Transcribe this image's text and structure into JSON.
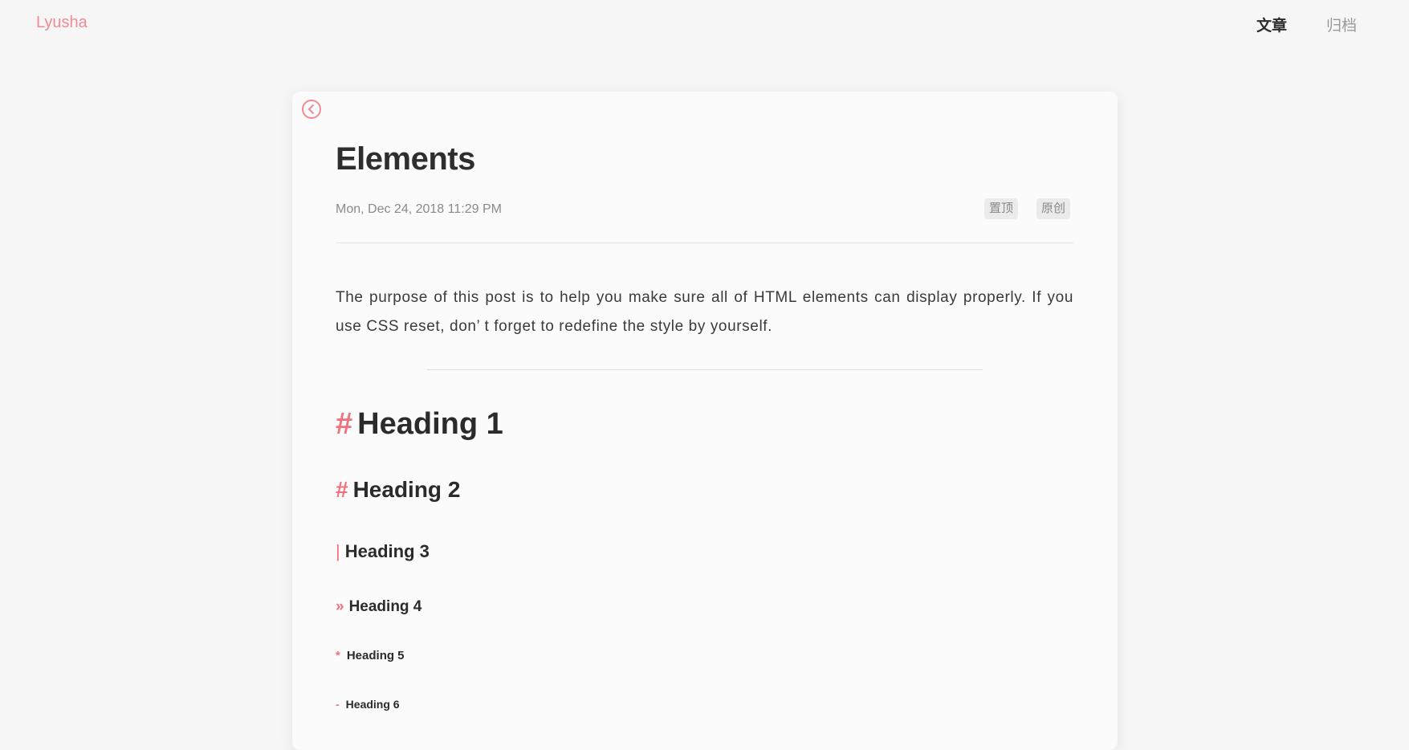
{
  "header": {
    "brand": "Lyusha",
    "nav": [
      {
        "label": "文章"
      },
      {
        "label": "归档"
      }
    ]
  },
  "post": {
    "title": "Elements",
    "date": "Mon, Dec 24, 2018 11:29 PM",
    "tags": [
      "置顶",
      "原创"
    ],
    "intro": "The purpose of this post is to help you make sure all of HTML elements can display properly. If you use CSS reset, don’ t forget to redefine the style by yourself.",
    "headings": [
      {
        "marker": "#",
        "text": "Heading 1"
      },
      {
        "marker": "#",
        "text": "Heading 2"
      },
      {
        "marker": "|",
        "text": "Heading 3"
      },
      {
        "marker": "»",
        "text": "Heading 4"
      },
      {
        "marker": "*",
        "text": "Heading 5"
      },
      {
        "marker": "-",
        "text": "Heading 6"
      }
    ]
  },
  "colors": {
    "accent": "#f08a93",
    "marker": "#f0707e",
    "background": "#f6f6f6",
    "card": "#fbfbfb"
  },
  "icons": {
    "back": "chevron-left-circle-icon"
  }
}
